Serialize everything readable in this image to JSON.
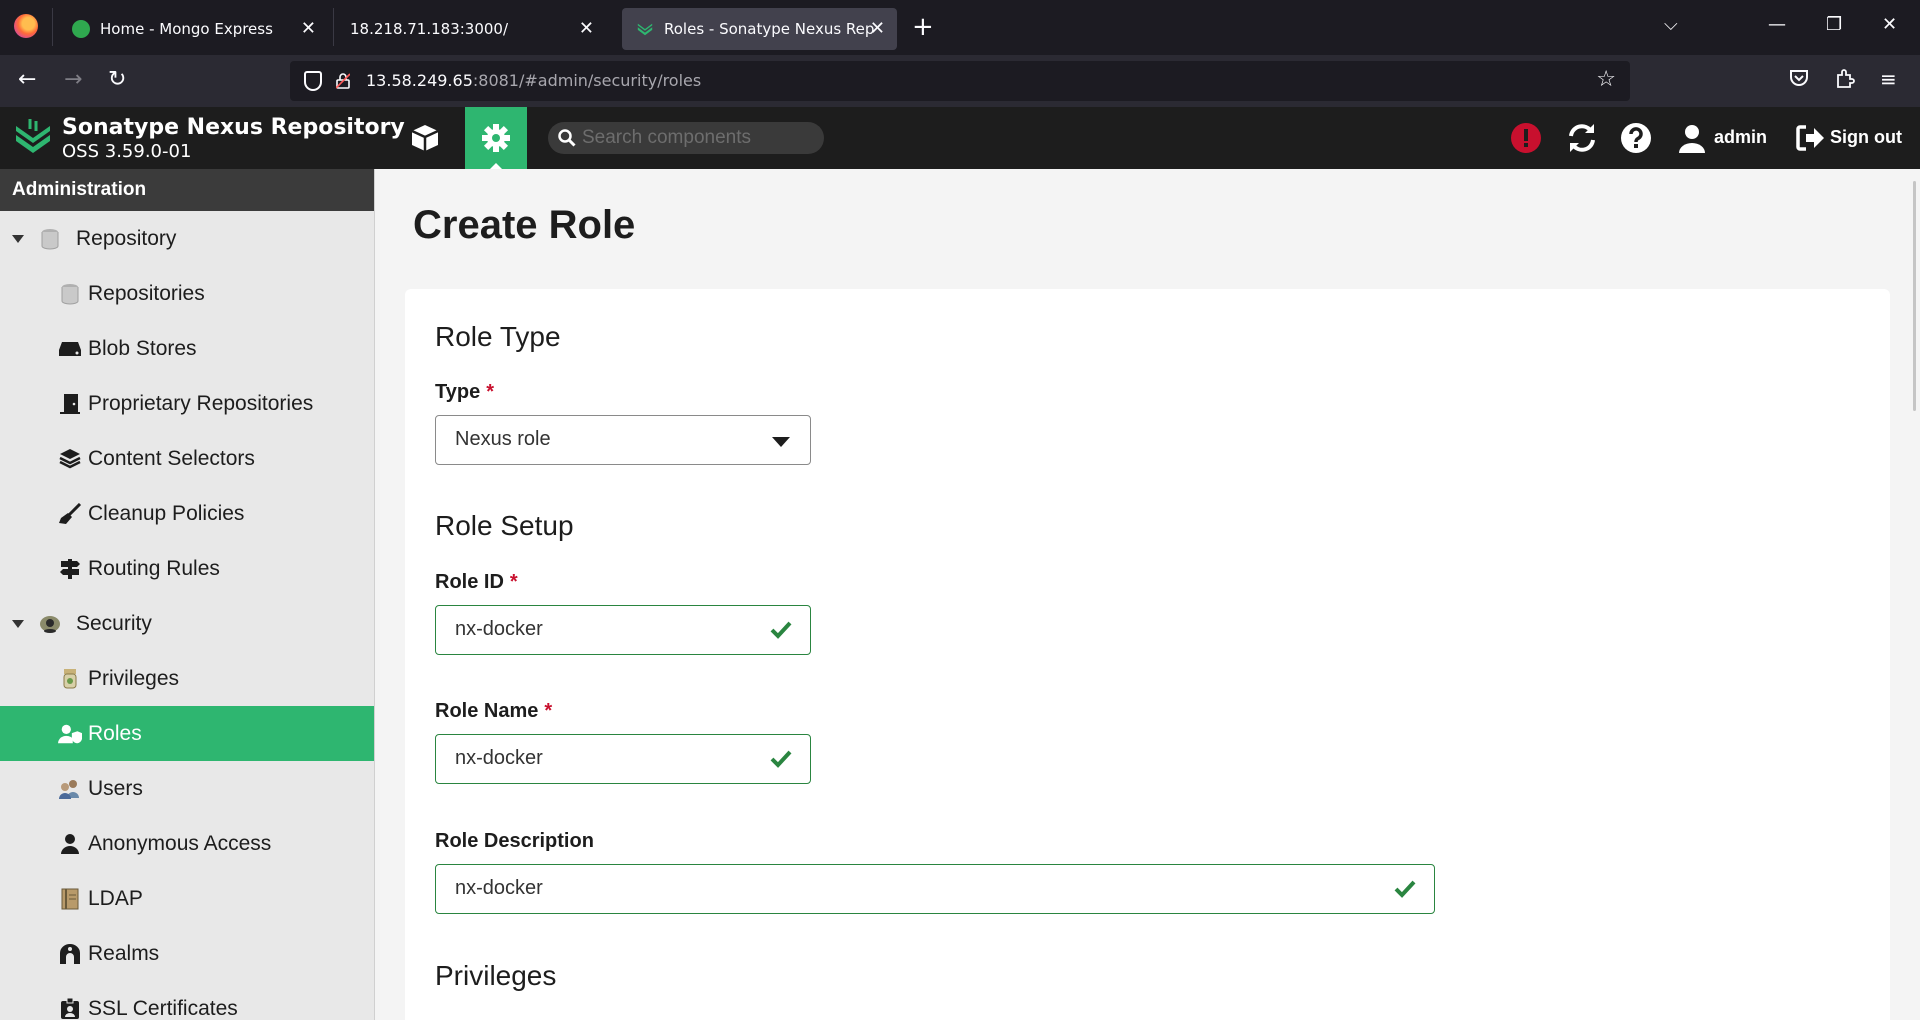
{
  "browser": {
    "tabs": [
      {
        "title": "Home - Mongo Express",
        "close": "✕"
      },
      {
        "title": "18.218.71.183:3000/",
        "close": "✕"
      },
      {
        "title": "Roles - Sonatype Nexus Repository",
        "close": "✕"
      }
    ],
    "new_tab": "+",
    "url_host": "13.58.249.65",
    "url_rest": ":8081/#admin/security/roles",
    "controls": {
      "list": "⌵",
      "minimize": "—",
      "restore": "❐",
      "close": "✕"
    },
    "nav": {
      "back": "←",
      "forward": "→",
      "reload": "↻",
      "star": "☆",
      "menu": "≡"
    }
  },
  "header": {
    "product_name": "Sonatype Nexus Repository",
    "version": "OSS 3.59.0-01",
    "search_placeholder": "Search components",
    "user": "admin",
    "sign_out": "Sign out"
  },
  "sidebar": {
    "title": "Administration",
    "groups": [
      {
        "label": "Repository",
        "items": [
          {
            "label": "Repositories"
          },
          {
            "label": "Blob Stores"
          },
          {
            "label": "Proprietary Repositories"
          },
          {
            "label": "Content Selectors"
          },
          {
            "label": "Cleanup Policies"
          },
          {
            "label": "Routing Rules"
          }
        ]
      },
      {
        "label": "Security",
        "items": [
          {
            "label": "Privileges"
          },
          {
            "label": "Roles",
            "active": true
          },
          {
            "label": "Users"
          },
          {
            "label": "Anonymous Access"
          },
          {
            "label": "LDAP"
          },
          {
            "label": "Realms"
          },
          {
            "label": "SSL Certificates"
          }
        ]
      }
    ]
  },
  "form": {
    "page_title": "Create Role",
    "role_type_section": "Role Type",
    "type_label": "Type",
    "type_value": "Nexus role",
    "role_setup_section": "Role Setup",
    "role_id_label": "Role ID",
    "role_id_value": "nx-docker",
    "role_name_label": "Role Name",
    "role_name_value": "nx-docker",
    "role_description_label": "Role Description",
    "role_description_value": "nx-docker",
    "privileges_section": "Privileges",
    "required_mark": "*"
  },
  "colors": {
    "accent": "#2eb670",
    "valid_border": "#2a8540",
    "required": "#c8102e",
    "alert": "#c8102e"
  }
}
